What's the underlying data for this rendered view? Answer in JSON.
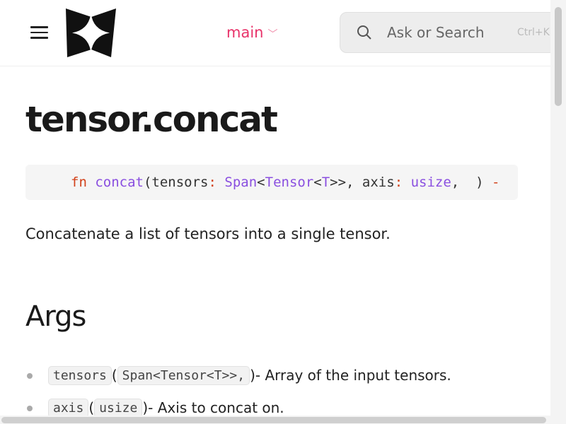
{
  "header": {
    "branch": "main",
    "search_placeholder": "Ask or Search",
    "search_shortcut": "Ctrl+K"
  },
  "page": {
    "title": "tensor.concat",
    "signature": {
      "kw": "fn",
      "name": "concat",
      "p1": "(tensors",
      "c1": ":",
      "t1": "Span",
      "lt1": "<",
      "t2": "Tensor",
      "lt2": "<",
      "t3": "T",
      "gt": ">>, axis",
      "c2": ":",
      "t4": "usize",
      "end": ",  ) ",
      "arrow": "-"
    },
    "description": "Concatenate a list of tensors into a single tensor.",
    "args_heading": "Args",
    "args": [
      {
        "name": "tensors",
        "type": " Span<Tensor<T>>,",
        "desc": " - Array of the input tensors."
      },
      {
        "name": "axis",
        "type": "usize",
        "desc": " - Axis to concat on."
      }
    ]
  },
  "colors": {
    "accent": "#e8336a",
    "keyword": "#d2411a",
    "type": "#8a4fe0"
  }
}
